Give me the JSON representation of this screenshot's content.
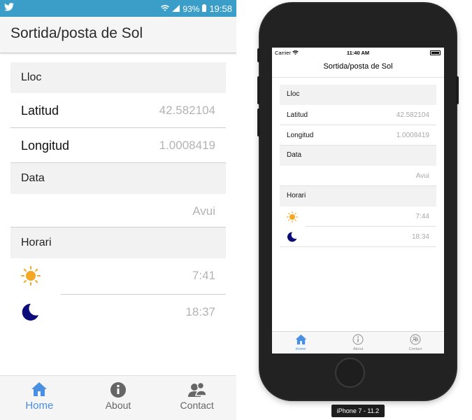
{
  "android": {
    "status": {
      "battery": "93%",
      "time": "19:58"
    },
    "title": "Sortida/posta de Sol",
    "sections": {
      "lloc": "Lloc",
      "data": "Data",
      "horari": "Horari"
    },
    "rows": {
      "latitud_label": "Latitud",
      "latitud_value": "42.582104",
      "longitud_label": "Longitud",
      "longitud_value": "1.0008419",
      "date_value": "Avui",
      "sunrise": "7:41",
      "sunset": "18:37"
    },
    "tabs": [
      {
        "label": "Home",
        "icon": "home-icon"
      },
      {
        "label": "About",
        "icon": "info-icon"
      },
      {
        "label": "Contact",
        "icon": "contact-icon"
      }
    ]
  },
  "iphone": {
    "status": {
      "carrier": "Carrier",
      "time": "11:40 AM"
    },
    "title": "Sortida/posta de Sol",
    "sections": {
      "lloc": "Lloc",
      "data": "Data",
      "horari": "Horari"
    },
    "rows": {
      "latitud_label": "Latitud",
      "latitud_value": "42.582104",
      "longitud_label": "Longitud",
      "longitud_value": "1.0008419",
      "date_value": "Avui",
      "sunrise": "7:44",
      "sunset": "18:34"
    },
    "tabs": [
      {
        "label": "Home",
        "icon": "home-icon"
      },
      {
        "label": "About",
        "icon": "info-icon"
      },
      {
        "label": "Contact",
        "icon": "contact-icon"
      }
    ],
    "device_label": "iPhone 7 - 11.2"
  },
  "colors": {
    "android_statusbar": "#3a9ec9",
    "accent": "#4a90e2",
    "sun": "#f5a623",
    "moon": "#0b0b7a"
  }
}
